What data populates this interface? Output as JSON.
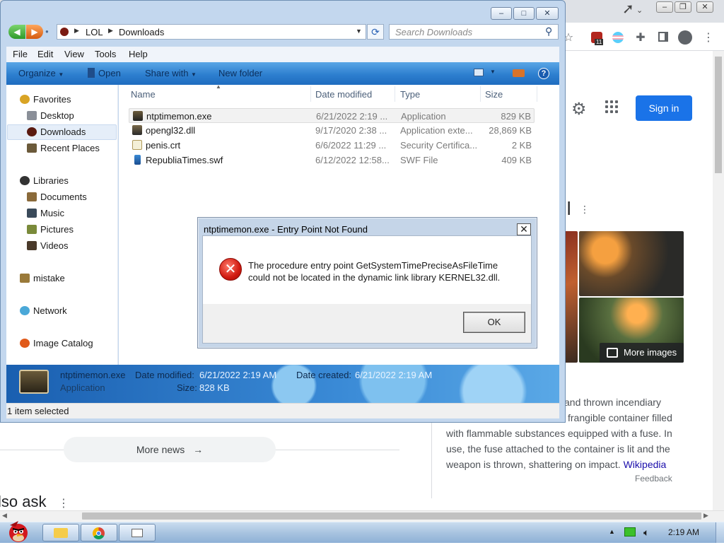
{
  "browser": {
    "signin_label": "Sign in",
    "kp_title_fragment": "il",
    "more_images_label": "More images",
    "kp_description": [
      "and thrown incendiary",
      "frangible container filled",
      "with flammable substances equipped with a fuse. In",
      "use, the fuse attached to the container is lit and the",
      "weapon is thrown, shattering on impact."
    ],
    "kp_source_link": "Wikipedia",
    "kp_feedback": "Feedback",
    "more_news_label": "More news",
    "paa_title": "lso ask",
    "extension_badge": "11"
  },
  "explorer": {
    "breadcrumb": [
      "LOL",
      "Downloads"
    ],
    "search_placeholder": "Search Downloads",
    "menu": [
      "File",
      "Edit",
      "View",
      "Tools",
      "Help"
    ],
    "commands": {
      "organize": "Organize",
      "open": "Open",
      "share_with": "Share with",
      "new_folder": "New folder"
    },
    "nav": {
      "favorites": "Favorites",
      "desktop": "Desktop",
      "downloads": "Downloads",
      "recent_places": "Recent Places",
      "libraries": "Libraries",
      "documents": "Documents",
      "music": "Music",
      "pictures": "Pictures",
      "videos": "Videos",
      "mistake": "mistake",
      "network": "Network",
      "image_catalog": "Image Catalog"
    },
    "columns": [
      "Name",
      "Date modified",
      "Type",
      "Size"
    ],
    "files": [
      {
        "name": "ntptimemon.exe",
        "date": "6/21/2022 2:19 ...",
        "type": "Application",
        "size": "829 KB"
      },
      {
        "name": "opengl32.dll",
        "date": "9/17/2020 2:38 ...",
        "type": "Application exte...",
        "size": "28,869 KB"
      },
      {
        "name": "penis.crt",
        "date": "6/6/2022 11:29 ...",
        "type": "Security Certifica...",
        "size": "2 KB"
      },
      {
        "name": "RepubliaTimes.swf",
        "date": "6/12/2022 12:58...",
        "type": "SWF File",
        "size": "409 KB"
      }
    ],
    "details": {
      "name": "ntptimemon.exe",
      "type": "Application",
      "date_modified_label": "Date modified:",
      "date_modified": "6/21/2022 2:19 AM",
      "date_created_label": "Date created:",
      "date_created": "6/21/2022 2:19 AM",
      "size_label": "Size:",
      "size": "828 KB"
    },
    "status": "1 item selected"
  },
  "dialog": {
    "title": "ntptimemon.exe - Entry Point Not Found",
    "message_line1": "The procedure entry point GetSystemTimePreciseAsFileTime",
    "message_line2": "could not be located in the dynamic link library KERNEL32.dll.",
    "ok_label": "OK",
    "close_glyph": "✕"
  },
  "taskbar": {
    "clock": "2:19 AM"
  },
  "colors": {
    "google_blue": "#1a73e8",
    "error_red": "#d01a10",
    "explorer_toolbar": "#2d7fcf"
  }
}
